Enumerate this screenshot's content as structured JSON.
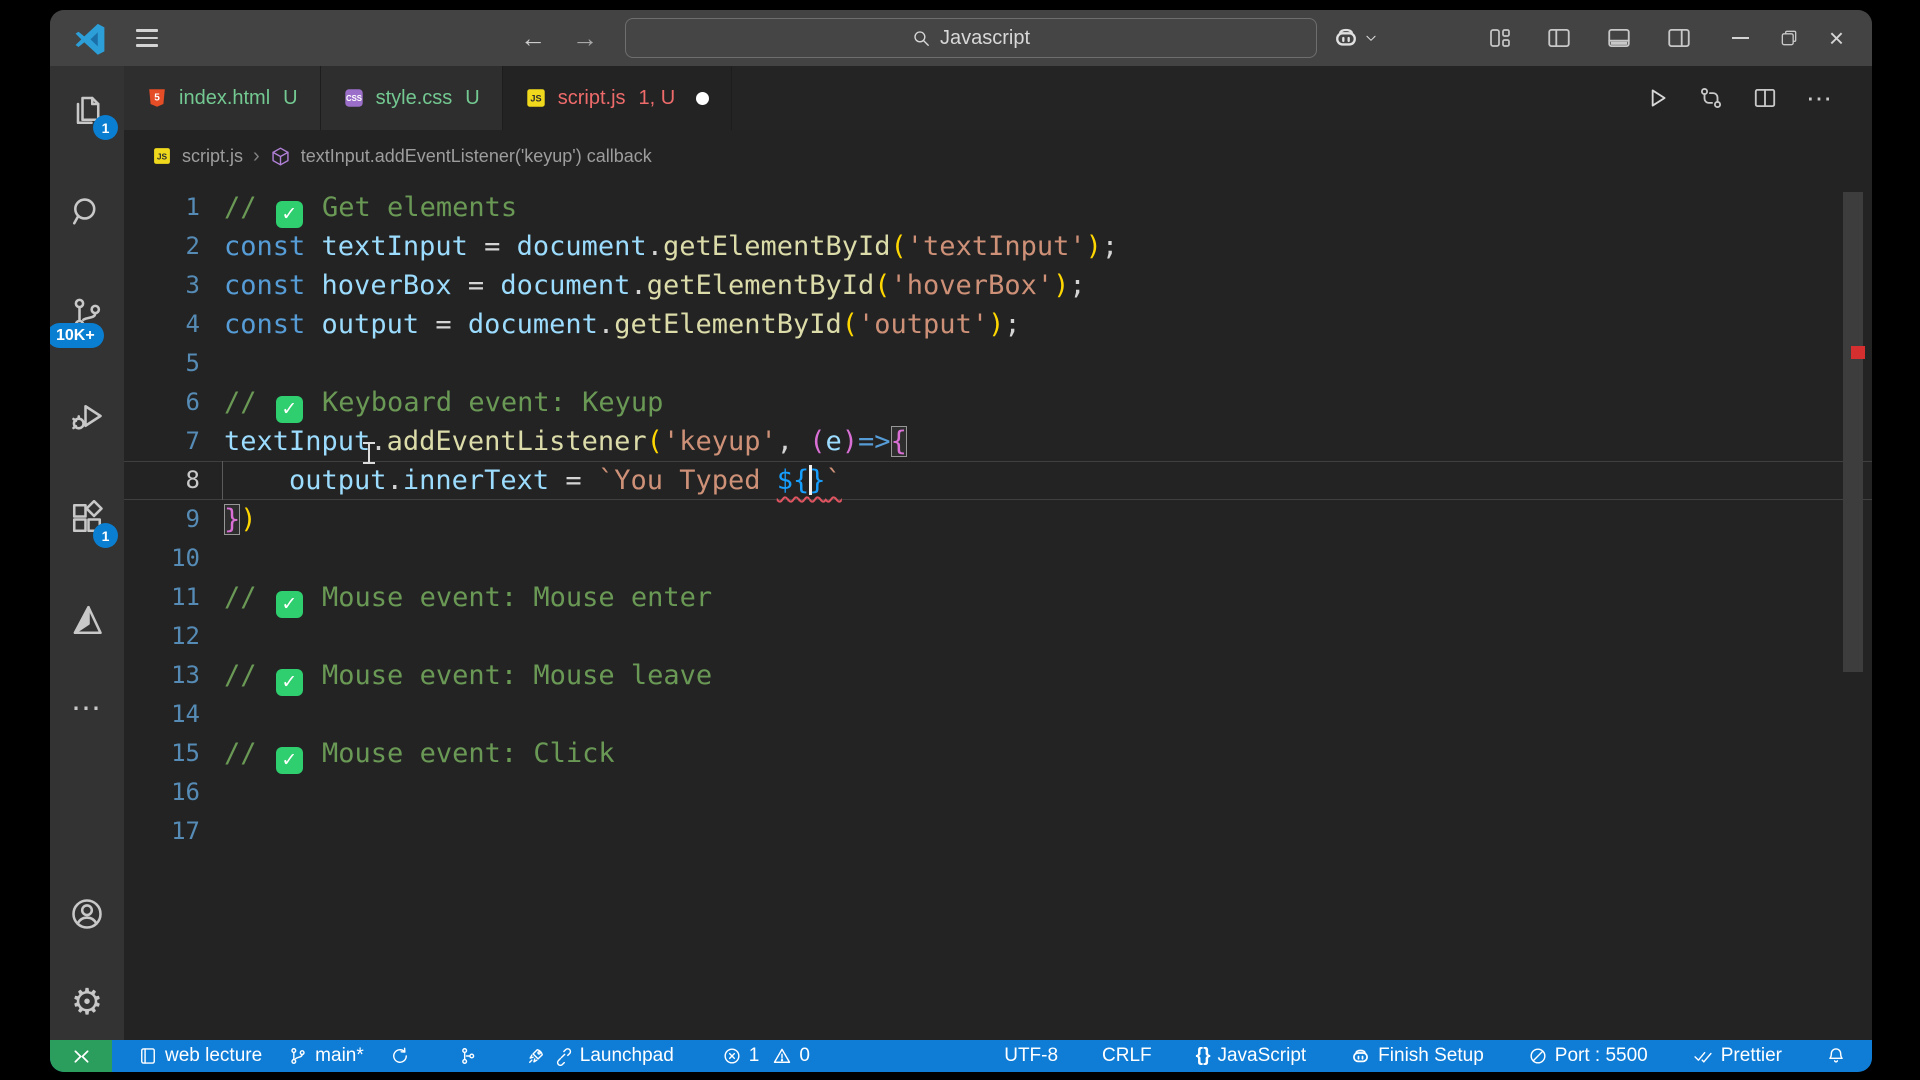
{
  "title_bar": {
    "search_label": "Javascript"
  },
  "tabs": [
    {
      "name": "index.html",
      "badge": "U"
    },
    {
      "name": "style.css",
      "badge": "U"
    },
    {
      "name": "script.js",
      "badge": "1, U"
    }
  ],
  "breadcrumb": {
    "file": "script.js",
    "separator": "›",
    "symbol": "textInput.addEventListener('keyup') callback"
  },
  "activity_bar": {
    "explorer_badge": "1",
    "scm_badge": "10K+",
    "extensions_badge": "1",
    "more_glyph": "⋯",
    "gear_glyph": "⚙"
  },
  "editor": {
    "active_line": 8,
    "palette": {
      "com": "#6A9955",
      "kw": "#569CD6",
      "var": "#9CDCFE",
      "fn": "#DCDCAA",
      "str": "#CE9178",
      "p": "#D4D4D4",
      "b1": "#FFD700",
      "b2": "#DA70D6",
      "b3": "#179FFF"
    },
    "lines": [
      {
        "num": 1,
        "tokens": [
          {
            "t": "// ",
            "c": "com"
          },
          {
            "check": true
          },
          {
            "t": " Get elements",
            "c": "com"
          }
        ]
      },
      {
        "num": 2,
        "tokens": [
          {
            "t": "const ",
            "c": "kw"
          },
          {
            "t": "textInput",
            "c": "var"
          },
          {
            "t": " = ",
            "c": "p"
          },
          {
            "t": "document",
            "c": "var"
          },
          {
            "t": ".",
            "c": "p"
          },
          {
            "t": "getElementById",
            "c": "fn"
          },
          {
            "t": "(",
            "c": "b1"
          },
          {
            "t": "'textInput'",
            "c": "str"
          },
          {
            "t": ")",
            "c": "b1"
          },
          {
            "t": ";",
            "c": "p"
          }
        ]
      },
      {
        "num": 3,
        "tokens": [
          {
            "t": "const ",
            "c": "kw"
          },
          {
            "t": "hoverBox",
            "c": "var"
          },
          {
            "t": " = ",
            "c": "p"
          },
          {
            "t": "document",
            "c": "var"
          },
          {
            "t": ".",
            "c": "p"
          },
          {
            "t": "getElementById",
            "c": "fn"
          },
          {
            "t": "(",
            "c": "b1"
          },
          {
            "t": "'hoverBox'",
            "c": "str"
          },
          {
            "t": ")",
            "c": "b1"
          },
          {
            "t": ";",
            "c": "p"
          }
        ]
      },
      {
        "num": 4,
        "tokens": [
          {
            "t": "const ",
            "c": "kw"
          },
          {
            "t": "output",
            "c": "var"
          },
          {
            "t": " = ",
            "c": "p"
          },
          {
            "t": "document",
            "c": "var"
          },
          {
            "t": ".",
            "c": "p"
          },
          {
            "t": "getElementById",
            "c": "fn"
          },
          {
            "t": "(",
            "c": "b1"
          },
          {
            "t": "'output'",
            "c": "str"
          },
          {
            "t": ")",
            "c": "b1"
          },
          {
            "t": ";",
            "c": "p"
          }
        ]
      },
      {
        "num": 5,
        "tokens": []
      },
      {
        "num": 6,
        "tokens": [
          {
            "t": "// ",
            "c": "com"
          },
          {
            "check": true
          },
          {
            "t": " Keyboard event: Keyup",
            "c": "com"
          }
        ]
      },
      {
        "num": 7,
        "tokens": [
          {
            "t": "textInput",
            "c": "var"
          },
          {
            "t": ".",
            "c": "p"
          },
          {
            "t": "addEventListener",
            "c": "fn"
          },
          {
            "t": "(",
            "c": "b1"
          },
          {
            "t": "'keyup'",
            "c": "str"
          },
          {
            "t": ", ",
            "c": "p"
          },
          {
            "t": "(",
            "c": "b2"
          },
          {
            "t": "e",
            "c": "var"
          },
          {
            "t": ")",
            "c": "b2"
          },
          {
            "t": "=>",
            "c": "kw"
          },
          {
            "t": "{",
            "c": "b2",
            "box": true
          }
        ]
      },
      {
        "num": 8,
        "tokens": [
          {
            "t": "    ",
            "c": "p"
          },
          {
            "t": "output",
            "c": "var"
          },
          {
            "t": ".",
            "c": "p"
          },
          {
            "t": "innerText",
            "c": "var"
          },
          {
            "t": " = ",
            "c": "p"
          },
          {
            "t": "`You Typed ",
            "c": "str"
          },
          {
            "t": "${",
            "c": "b3",
            "sq": true
          },
          {
            "caret": true
          },
          {
            "t": "}",
            "c": "b3",
            "sq": true
          },
          {
            "t": "`",
            "c": "str",
            "sq": true
          }
        ]
      },
      {
        "num": 9,
        "tokens": [
          {
            "t": "}",
            "c": "b2",
            "box": true
          },
          {
            "t": ")",
            "c": "b1"
          }
        ]
      },
      {
        "num": 10,
        "tokens": []
      },
      {
        "num": 11,
        "tokens": [
          {
            "t": "// ",
            "c": "com"
          },
          {
            "check": true
          },
          {
            "t": " Mouse event: Mouse enter",
            "c": "com"
          }
        ]
      },
      {
        "num": 12,
        "tokens": []
      },
      {
        "num": 13,
        "tokens": [
          {
            "t": "// ",
            "c": "com"
          },
          {
            "check": true
          },
          {
            "t": " Mouse event: Mouse leave",
            "c": "com"
          }
        ]
      },
      {
        "num": 14,
        "tokens": []
      },
      {
        "num": 15,
        "tokens": [
          {
            "t": "// ",
            "c": "com"
          },
          {
            "check": true
          },
          {
            "t": " Mouse event: Click",
            "c": "com"
          }
        ]
      },
      {
        "num": 16,
        "tokens": []
      },
      {
        "num": 17,
        "tokens": []
      }
    ]
  },
  "status_bar": {
    "workspace": "web lecture",
    "branch": "main*",
    "launchpad": "Launchpad",
    "errors": "1",
    "warnings": "0",
    "encoding": "UTF-8",
    "eol": "CRLF",
    "language": "JavaScript",
    "braces_glyph": "{}",
    "copilot": "Finish Setup",
    "port": "Port : 5500",
    "formatter": "Prettier"
  },
  "colors": {
    "statusbar_blue": "#0f7cd6",
    "remote_green": "#2b9e5e",
    "badge_blue": "#0a7ed1",
    "untracked_green": "#73c991",
    "error_red": "#ef6b6b",
    "check_green": "#2fce6f"
  }
}
